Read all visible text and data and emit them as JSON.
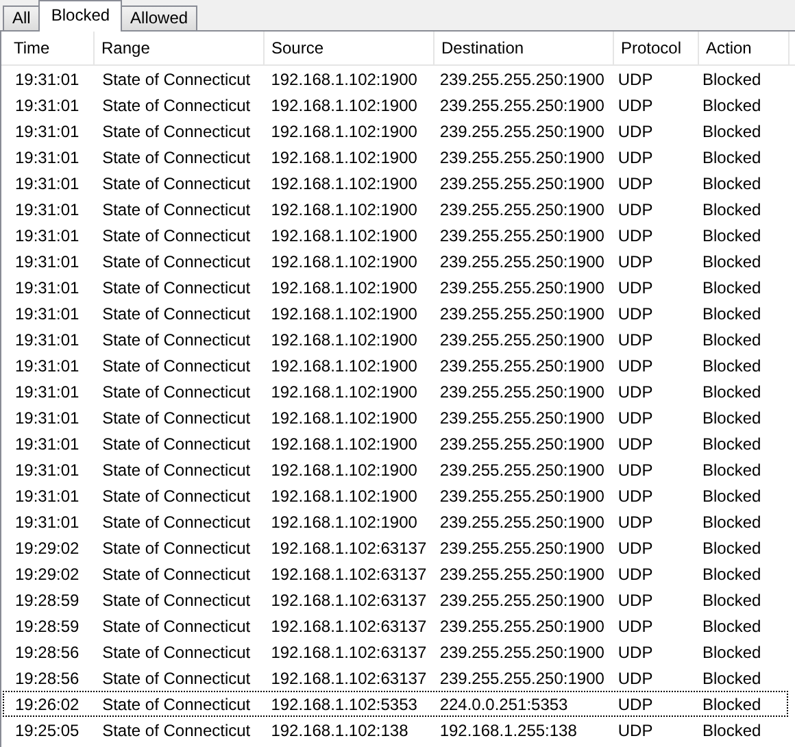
{
  "tabs": [
    {
      "label": "All",
      "selected": false
    },
    {
      "label": "Blocked",
      "selected": true
    },
    {
      "label": "Allowed",
      "selected": false
    }
  ],
  "table": {
    "columns": [
      "Time",
      "Range",
      "Source",
      "Destination",
      "Protocol",
      "Action"
    ],
    "rows": [
      {
        "cells": [
          "19:31:01",
          "State of Connecticut",
          "192.168.1.102:1900",
          "239.255.255.250:1900",
          "UDP",
          "Blocked"
        ],
        "focused": false
      },
      {
        "cells": [
          "19:31:01",
          "State of Connecticut",
          "192.168.1.102:1900",
          "239.255.255.250:1900",
          "UDP",
          "Blocked"
        ],
        "focused": false
      },
      {
        "cells": [
          "19:31:01",
          "State of Connecticut",
          "192.168.1.102:1900",
          "239.255.255.250:1900",
          "UDP",
          "Blocked"
        ],
        "focused": false
      },
      {
        "cells": [
          "19:31:01",
          "State of Connecticut",
          "192.168.1.102:1900",
          "239.255.255.250:1900",
          "UDP",
          "Blocked"
        ],
        "focused": false
      },
      {
        "cells": [
          "19:31:01",
          "State of Connecticut",
          "192.168.1.102:1900",
          "239.255.255.250:1900",
          "UDP",
          "Blocked"
        ],
        "focused": false
      },
      {
        "cells": [
          "19:31:01",
          "State of Connecticut",
          "192.168.1.102:1900",
          "239.255.255.250:1900",
          "UDP",
          "Blocked"
        ],
        "focused": false
      },
      {
        "cells": [
          "19:31:01",
          "State of Connecticut",
          "192.168.1.102:1900",
          "239.255.255.250:1900",
          "UDP",
          "Blocked"
        ],
        "focused": false
      },
      {
        "cells": [
          "19:31:01",
          "State of Connecticut",
          "192.168.1.102:1900",
          "239.255.255.250:1900",
          "UDP",
          "Blocked"
        ],
        "focused": false
      },
      {
        "cells": [
          "19:31:01",
          "State of Connecticut",
          "192.168.1.102:1900",
          "239.255.255.250:1900",
          "UDP",
          "Blocked"
        ],
        "focused": false
      },
      {
        "cells": [
          "19:31:01",
          "State of Connecticut",
          "192.168.1.102:1900",
          "239.255.255.250:1900",
          "UDP",
          "Blocked"
        ],
        "focused": false
      },
      {
        "cells": [
          "19:31:01",
          "State of Connecticut",
          "192.168.1.102:1900",
          "239.255.255.250:1900",
          "UDP",
          "Blocked"
        ],
        "focused": false
      },
      {
        "cells": [
          "19:31:01",
          "State of Connecticut",
          "192.168.1.102:1900",
          "239.255.255.250:1900",
          "UDP",
          "Blocked"
        ],
        "focused": false
      },
      {
        "cells": [
          "19:31:01",
          "State of Connecticut",
          "192.168.1.102:1900",
          "239.255.255.250:1900",
          "UDP",
          "Blocked"
        ],
        "focused": false
      },
      {
        "cells": [
          "19:31:01",
          "State of Connecticut",
          "192.168.1.102:1900",
          "239.255.255.250:1900",
          "UDP",
          "Blocked"
        ],
        "focused": false
      },
      {
        "cells": [
          "19:31:01",
          "State of Connecticut",
          "192.168.1.102:1900",
          "239.255.255.250:1900",
          "UDP",
          "Blocked"
        ],
        "focused": false
      },
      {
        "cells": [
          "19:31:01",
          "State of Connecticut",
          "192.168.1.102:1900",
          "239.255.255.250:1900",
          "UDP",
          "Blocked"
        ],
        "focused": false
      },
      {
        "cells": [
          "19:31:01",
          "State of Connecticut",
          "192.168.1.102:1900",
          "239.255.255.250:1900",
          "UDP",
          "Blocked"
        ],
        "focused": false
      },
      {
        "cells": [
          "19:31:01",
          "State of Connecticut",
          "192.168.1.102:1900",
          "239.255.255.250:1900",
          "UDP",
          "Blocked"
        ],
        "focused": false
      },
      {
        "cells": [
          "19:29:02",
          "State of Connecticut",
          "192.168.1.102:63137",
          "239.255.255.250:1900",
          "UDP",
          "Blocked"
        ],
        "focused": false
      },
      {
        "cells": [
          "19:29:02",
          "State of Connecticut",
          "192.168.1.102:63137",
          "239.255.255.250:1900",
          "UDP",
          "Blocked"
        ],
        "focused": false
      },
      {
        "cells": [
          "19:28:59",
          "State of Connecticut",
          "192.168.1.102:63137",
          "239.255.255.250:1900",
          "UDP",
          "Blocked"
        ],
        "focused": false
      },
      {
        "cells": [
          "19:28:59",
          "State of Connecticut",
          "192.168.1.102:63137",
          "239.255.255.250:1900",
          "UDP",
          "Blocked"
        ],
        "focused": false
      },
      {
        "cells": [
          "19:28:56",
          "State of Connecticut",
          "192.168.1.102:63137",
          "239.255.255.250:1900",
          "UDP",
          "Blocked"
        ],
        "focused": false
      },
      {
        "cells": [
          "19:28:56",
          "State of Connecticut",
          "192.168.1.102:63137",
          "239.255.255.250:1900",
          "UDP",
          "Blocked"
        ],
        "focused": false
      },
      {
        "cells": [
          "19:26:02",
          "State of Connecticut",
          "192.168.1.102:5353",
          "224.0.0.251:5353",
          "UDP",
          "Blocked"
        ],
        "focused": true
      },
      {
        "cells": [
          "19:25:05",
          "State of Connecticut",
          "192.168.1.102:138",
          "192.168.1.255:138",
          "UDP",
          "Blocked"
        ],
        "focused": false
      }
    ]
  }
}
